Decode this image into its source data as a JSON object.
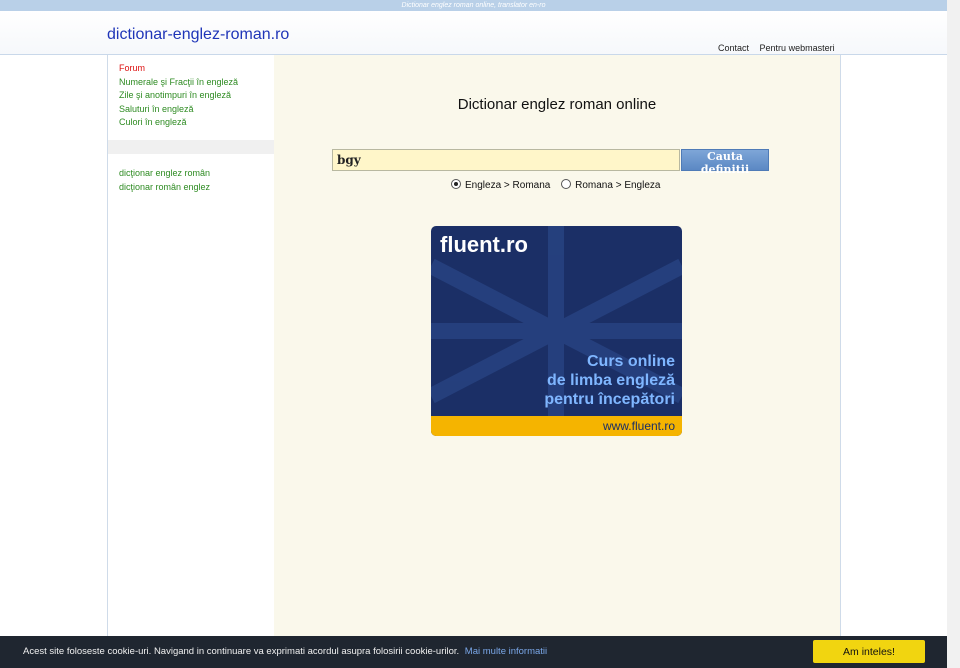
{
  "topbar": {
    "tagline": "Dictionar englez roman online, translator en-ro"
  },
  "header": {
    "site_title": "dictionar-englez-roman.ro",
    "links": [
      "Contact",
      "Pentru webmasteri"
    ]
  },
  "sidebar": {
    "items": [
      {
        "label": "Forum"
      },
      {
        "label": "Numerale şi Fracţii în engleză"
      },
      {
        "label": "Zile şi anotimpuri în engleză"
      },
      {
        "label": "Saluturi în engleză"
      },
      {
        "label": "Culori în engleză"
      }
    ],
    "items2": [
      {
        "label": "dicţionar englez român"
      },
      {
        "label": "dicţionar român englez"
      }
    ]
  },
  "main": {
    "title": "Dictionar englez roman online",
    "search_value": "bgy",
    "search_button": "Cauta definitii",
    "options": [
      "Engleza > Romana",
      "Romana > Engleza"
    ],
    "selected_option": 0
  },
  "ad": {
    "brand": "fluent.ro",
    "slogan": [
      "Curs online",
      "de limba engleză",
      "pentru începători"
    ],
    "url": "www.fluent.ro",
    "colors": {
      "bg": "#1b2f66",
      "accent": "#7fb6ff",
      "footer": "#f5b400"
    }
  },
  "cookie": {
    "text": "Acest site foloseste cookie-uri. Navigand in continuare va exprimati acordul asupra folosirii cookie-urilor.",
    "link": "Mai multe informatii",
    "button": "Am inteles!"
  }
}
